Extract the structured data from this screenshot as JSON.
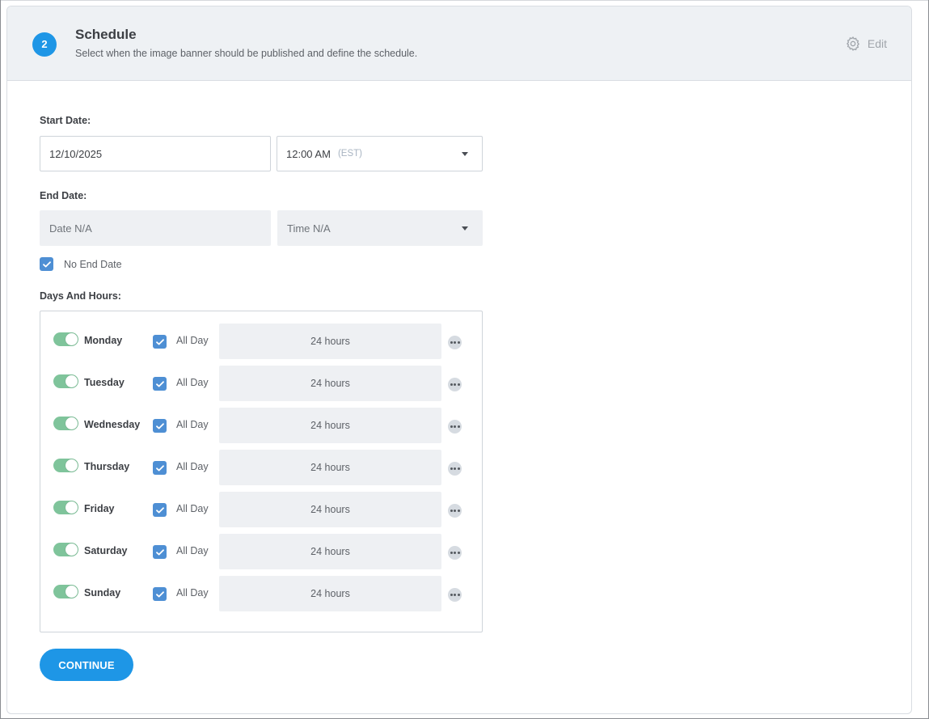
{
  "header": {
    "step_number": "2",
    "title": "Schedule",
    "subtitle": "Select when the image banner should be published and define the schedule.",
    "edit_label": "Edit"
  },
  "start_date": {
    "label": "Start Date:",
    "date_value": "12/10/2025",
    "time_value": "12:00 AM",
    "timezone": "(EST)"
  },
  "end_date": {
    "label": "End Date:",
    "date_placeholder": "Date N/A",
    "time_placeholder": "Time N/A",
    "no_end_date_label": "No End Date",
    "no_end_date_checked": true
  },
  "days_and_hours": {
    "label": "Days And Hours:",
    "all_day_label": "All Day",
    "days": [
      {
        "name": "Monday",
        "enabled": true,
        "all_day": true,
        "hours": "24 hours"
      },
      {
        "name": "Tuesday",
        "enabled": true,
        "all_day": true,
        "hours": "24 hours"
      },
      {
        "name": "Wednesday",
        "enabled": true,
        "all_day": true,
        "hours": "24 hours"
      },
      {
        "name": "Thursday",
        "enabled": true,
        "all_day": true,
        "hours": "24 hours"
      },
      {
        "name": "Friday",
        "enabled": true,
        "all_day": true,
        "hours": "24 hours"
      },
      {
        "name": "Saturday",
        "enabled": true,
        "all_day": true,
        "hours": "24 hours"
      },
      {
        "name": "Sunday",
        "enabled": true,
        "all_day": true,
        "hours": "24 hours"
      }
    ]
  },
  "actions": {
    "continue_label": "CONTINUE"
  },
  "icons": {
    "edit": "gear-icon",
    "check": "check-icon",
    "more": "more-options-icon",
    "dropdown": "chevron-down-icon"
  },
  "colors": {
    "accent": "#1e96e6",
    "checkbox": "#4e8fd4",
    "toggle_on": "#7fc49b",
    "header_bg": "#eef1f4"
  }
}
